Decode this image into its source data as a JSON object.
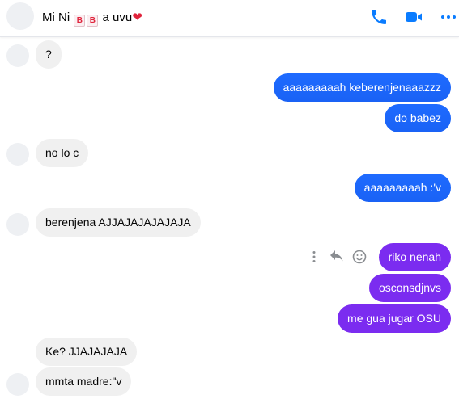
{
  "header": {
    "name_prefix": "Mi Ni",
    "emoji_letter_1": "B",
    "emoji_letter_2": "B",
    "name_suffix": "a uvu",
    "heart": "❤",
    "icons": [
      "phone-icon",
      "video-camera-icon",
      "more-options-icon"
    ],
    "accent_color": "#0a7cff"
  },
  "messages": [
    {
      "text": "?",
      "direction": "incoming"
    },
    {
      "text": "aaaaaaaaah keberenjenaaazzz",
      "direction": "outgoing"
    },
    {
      "text": "do babez",
      "direction": "outgoing"
    },
    {
      "text": "no lo c",
      "direction": "incoming"
    },
    {
      "text": "aaaaaaaaah :'v",
      "direction": "outgoing"
    },
    {
      "text": "berenjena AJJAJAJAJAJAJA",
      "direction": "incoming"
    },
    {
      "text": "riko nenah",
      "direction": "outgoing"
    },
    {
      "text": "osconsdjnvs",
      "direction": "outgoing"
    },
    {
      "text": "me gua jugar OSU",
      "direction": "outgoing"
    },
    {
      "text": "Ke? JJAJAJAJA",
      "direction": "incoming"
    },
    {
      "text": "mmta madre:\"v",
      "direction": "incoming"
    }
  ],
  "message_actions": [
    "more-vertical-icon",
    "reply-icon",
    "react-smiley-icon"
  ],
  "colors": {
    "outgoing_blue": "#1e6bff",
    "outgoing_purple": "#7b2cf0",
    "incoming_bg": "#f0f0f0"
  }
}
